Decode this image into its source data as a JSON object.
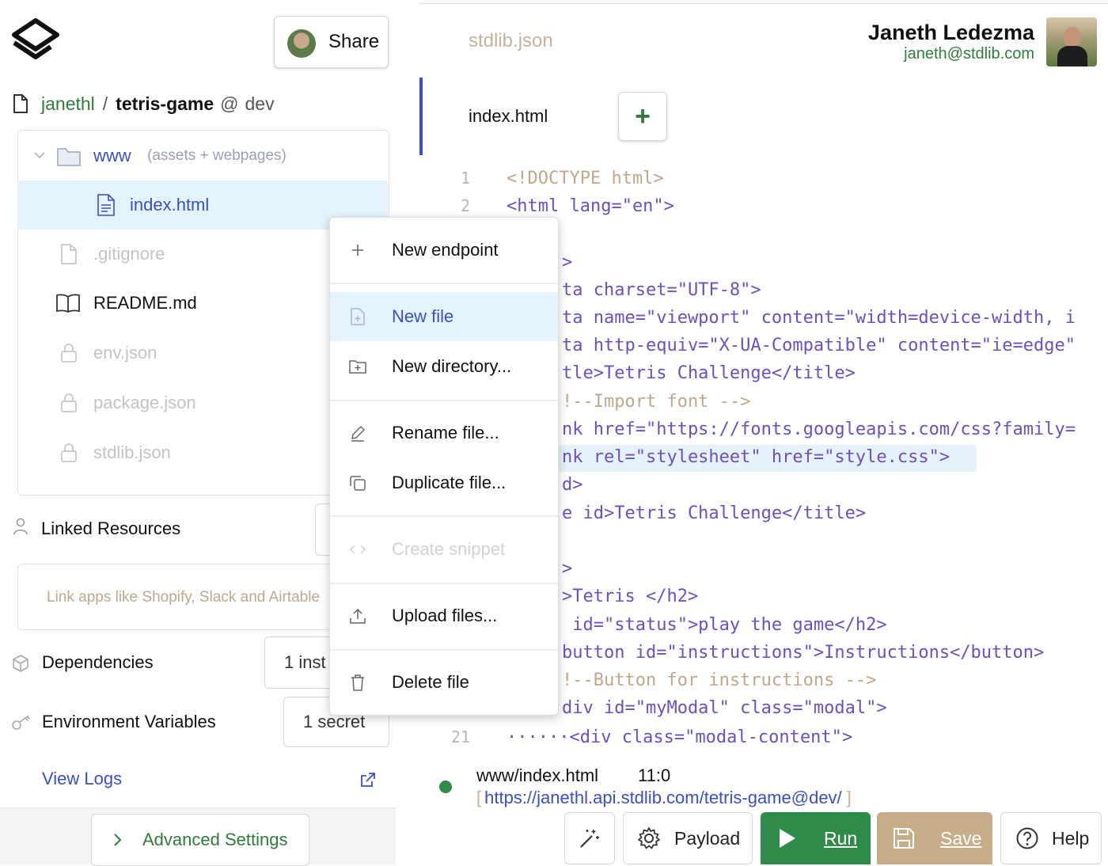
{
  "header": {
    "share_label": "Share",
    "file_tab_top": "stdlib.json",
    "user_name": "Janeth Ledezma",
    "user_email": "janeth@stdlib.com"
  },
  "project": {
    "owner": "janethl",
    "separator": "/",
    "name": "tetris-game",
    "at": "@",
    "env": "dev"
  },
  "tree": {
    "folder_name": "www",
    "folder_hint": "(assets + webpages)",
    "items": [
      {
        "label": "index.html"
      },
      {
        "label": ".gitignore"
      },
      {
        "label": "README.md"
      },
      {
        "label": "env.json"
      },
      {
        "label": "package.json"
      },
      {
        "label": "stdlib.json"
      }
    ]
  },
  "sidebar": {
    "linked_resources": "Linked Resources",
    "link_hint": "Link apps like Shopify, Slack and Airtable",
    "dependencies": "Dependencies",
    "dependencies_btn": "1 inst",
    "env_vars": "Environment Variables",
    "env_vars_btn": "1 secret",
    "view_logs": "View Logs",
    "advanced_settings": "Advanced Settings"
  },
  "context_menu": {
    "items": [
      {
        "label": "New endpoint",
        "icon": "plus-icon"
      },
      {
        "label": "New file",
        "icon": "new-file-icon"
      },
      {
        "label": "New directory...",
        "icon": "new-folder-icon"
      },
      {
        "label": "Rename file...",
        "icon": "pencil-icon"
      },
      {
        "label": "Duplicate file...",
        "icon": "duplicate-icon"
      },
      {
        "label": "Create snippet",
        "icon": "code-icon"
      },
      {
        "label": "Upload files...",
        "icon": "upload-icon"
      },
      {
        "label": "Delete file",
        "icon": "trash-icon"
      }
    ]
  },
  "editor": {
    "active_tab": "index.html",
    "add_tab": "+",
    "line_numbers": [
      "1",
      "2",
      "21"
    ],
    "lines": [
      "<!DOCTYPE html>",
      "<html lang=\"en\">",
      ">",
      "ta charset=\"UTF-8\">",
      "ta name=\"viewport\" content=\"width=device-width, i",
      "ta http-equiv=\"X-UA-Compatible\" content=\"ie=edge\"",
      "tle>Tetris Challenge</title>",
      "!--Import font -->",
      "nk href=\"https://fonts.googleapis.com/css?family=",
      "nk rel=\"stylesheet\" href=\"style.css\">",
      "d>",
      "e id>Tetris Challenge</title>",
      ">",
      ">Tetris </h2>",
      " id=\"status\">play the game</h2>",
      "button id=\"instructions\">Instructions</button>",
      "!--Button for instructions -->",
      "div id=\"myModal\" class=\"modal\">",
      "······<div class=\"modal-content\">"
    ]
  },
  "status": {
    "file": "www/index.html",
    "position": "11:0",
    "bracket_open": "[",
    "url": "https://janethl.api.stdlib.com/tetris-game@dev/",
    "bracket_close": "]"
  },
  "toolbar": {
    "payload": "Payload",
    "run": "Run",
    "save": "Save",
    "help": "Help"
  },
  "colors": {
    "accent_blue": "#3b4fc4",
    "run_green": "#2e8b4a",
    "save_tan": "#c8ad8a",
    "selection_bg": "#e4f3fc"
  }
}
